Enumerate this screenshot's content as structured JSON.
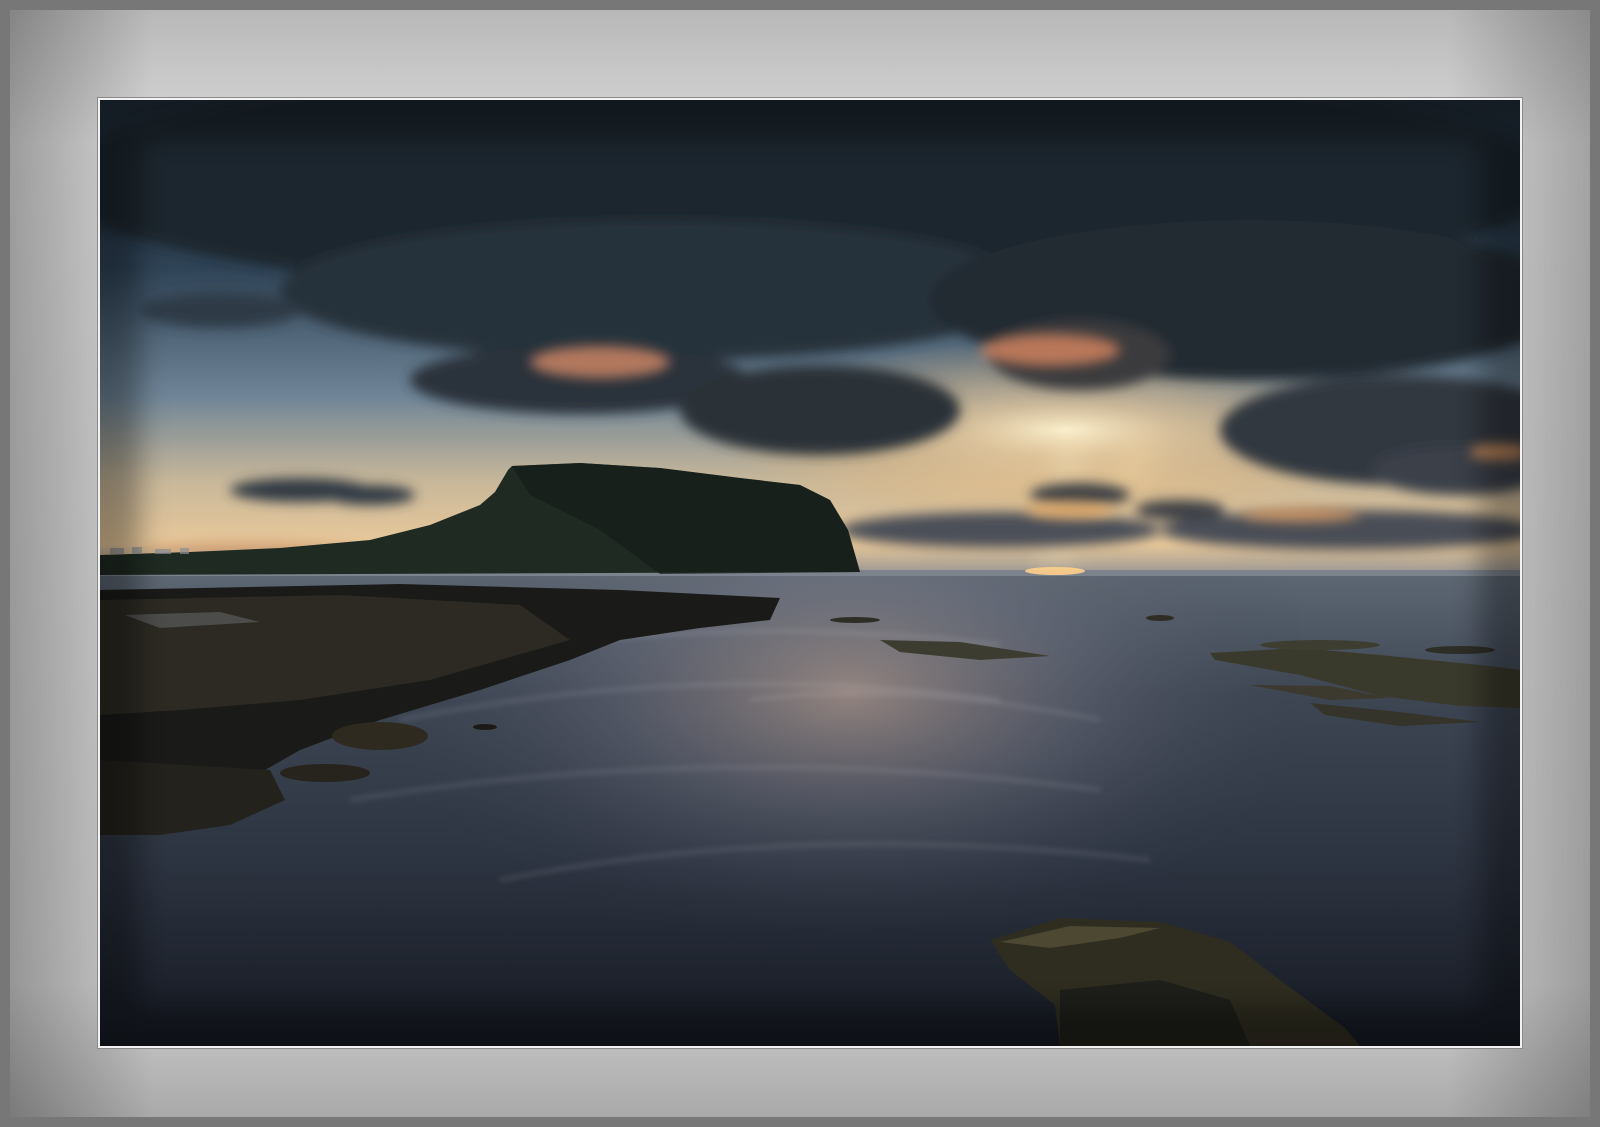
{
  "scene": {
    "subject": "coastal-sunset",
    "palette": {
      "mat_light": "#d9d9d9",
      "mat_dark": "#a9a9a9",
      "outer_border": "#777777",
      "inner_border": "#f2f2f2",
      "sky_top": "#1f2a36",
      "sky_horizon": "#e8c89a",
      "sun_glow": "#ffb45a",
      "cloud_dark": "#2a3038",
      "cloud_lit": "#e0906a",
      "headland": "#1f2a22",
      "water": "#2d3441",
      "rock": "#2c2a22"
    }
  }
}
